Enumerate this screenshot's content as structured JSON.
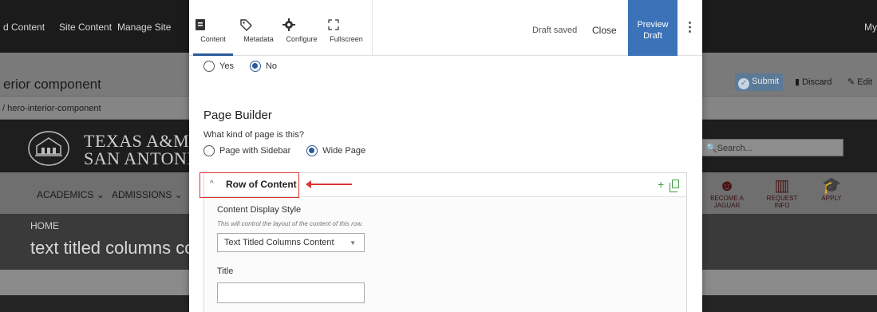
{
  "site": {
    "nav": [
      "d Content",
      "Site Content",
      "Manage Site"
    ],
    "top_right": "My",
    "page_title": "erior component",
    "breadcrumb": "/ hero-interior-component",
    "logo_line1": "TEXAS A&M U",
    "logo_line2": "SAN ANTONIO",
    "search_placeholder": "Search...",
    "menu": [
      "ACADEMICS",
      "ADMISSIONS"
    ],
    "quick_links": [
      "BECOME A JAGUAR",
      "REQUEST INFO",
      "APPLY"
    ],
    "hero_home": "HOME",
    "hero_title": "text titled columns co",
    "submit_label": "Submit",
    "discard_label": "Discard",
    "edit_label": "Edit"
  },
  "editor": {
    "tabs": [
      {
        "label": "Content",
        "icon": "content-icon",
        "active": true
      },
      {
        "label": "Metadata",
        "icon": "tag-icon",
        "active": false
      },
      {
        "label": "Configure",
        "icon": "gear-icon",
        "active": false
      },
      {
        "label": "Fullscreen",
        "icon": "fullscreen-icon",
        "active": false
      }
    ],
    "draft_status": "Draft saved",
    "close_label": "Close",
    "preview_line1": "Preview",
    "preview_line2": "Draft",
    "yes_no": {
      "yes": "Yes",
      "no": "No",
      "selected": "No"
    },
    "page_builder_title": "Page Builder",
    "page_kind_question": "What kind of page is this?",
    "page_kind_options": {
      "sidebar": "Page with Sidebar",
      "wide": "Wide Page",
      "selected": "Wide Page"
    },
    "row": {
      "label": "Row of Content",
      "display_style_label": "Content Display Style",
      "display_style_help": "This will control the layout of the content of this row.",
      "display_style_value": "Text Titled Columns Content",
      "title_label": "Title",
      "title_value": ""
    },
    "accent_color": "#3b72b8",
    "highlight_color": "#dd3333"
  }
}
